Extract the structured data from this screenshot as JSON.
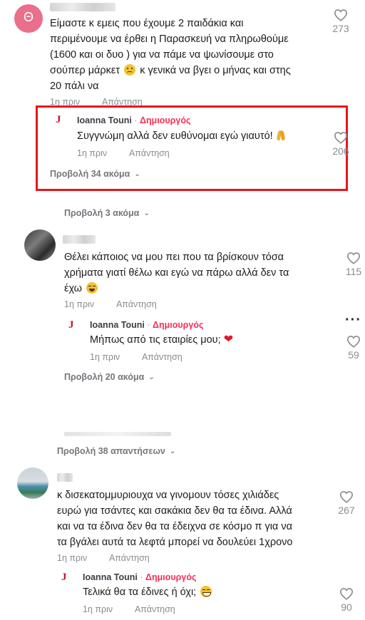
{
  "comments": [
    {
      "avatar_letter": "Θ",
      "avatar_color": "#e96f8c",
      "text_lines": [
        "Είμαστε κ εμεις που έχουμε 2 παιδάκια και",
        "περιμένουμε να έρθει η Παρασκευή να πληρωθούμε",
        "(1600 και οι δυο ) για να πάμε να ψωνίσουμε στο",
        "σούπερ μάρκετ",
        "κ γενικά να βγει ο μήνας και στης",
        "20 πάλι να"
      ],
      "time": "1η πριν",
      "reply_label": "Απάντηση",
      "likes": "273",
      "reply": {
        "author": "Ioanna Touni",
        "separator": "·",
        "badge": "Δημιουργός",
        "text": "Συγγνώμη αλλά δεν ευθύνομαι εγώ γιαυτό!",
        "time": "1η πριν",
        "reply_label": "Απάντηση",
        "likes": "206"
      },
      "view_more_inner": "Προβολή 34 ακόμα",
      "view_more_outer": "Προβολή 3 ακόμα"
    },
    {
      "text_lines": [
        "Θέλει κάποιος να μου πει που τα βρίσκουν τόσα",
        "χρήματα γιατί θέλω και εγώ να πάρω αλλά δεν τα",
        "έχω"
      ],
      "time": "1η πριν",
      "reply_label": "Απάντηση",
      "likes": "115",
      "reply": {
        "author": "Ioanna Touni",
        "separator": "·",
        "badge": "Δημιουργός",
        "text": "Μήπως από τις εταιρίες μου;",
        "time": "1η πριν",
        "reply_label": "Απάντηση",
        "likes": "59"
      },
      "view_more": "Προβολή 20 ακόμα"
    },
    {
      "view_replies": "Προβολή 38 απαντήσεων"
    },
    {
      "text_lines": [
        "κ δισεκατομμυριουχα να γινομουν τόσες χιλιάδες",
        "ευρώ για τσάντες και σακάκια δεν θα τα έδινα. Αλλά",
        "και να τα έδινα δεν θα τα έδειχνα σε κόσμο π για να",
        "τα βγάλει αυτά τα λεφτά μπορεί να δουλεύει 1χρονο"
      ],
      "time": "1η πριν",
      "reply_label": "Απάντηση",
      "likes": "267",
      "reply": {
        "author": "Ioanna Touni",
        "separator": "·",
        "badge": "Δημιουργός",
        "text": "Τελικά θα τα έδινες ή όχι;",
        "time": "1η πριν",
        "reply_label": "Απάντηση",
        "likes": "90"
      }
    }
  ],
  "icons": {
    "like": "heart-outline-icon",
    "chevron": "chevron-down-icon",
    "more": "more-options-icon",
    "creator_logo": "J"
  },
  "colors": {
    "highlight": "#e6151b",
    "badge": "#fe2c55",
    "muted": "#8a8b91"
  }
}
